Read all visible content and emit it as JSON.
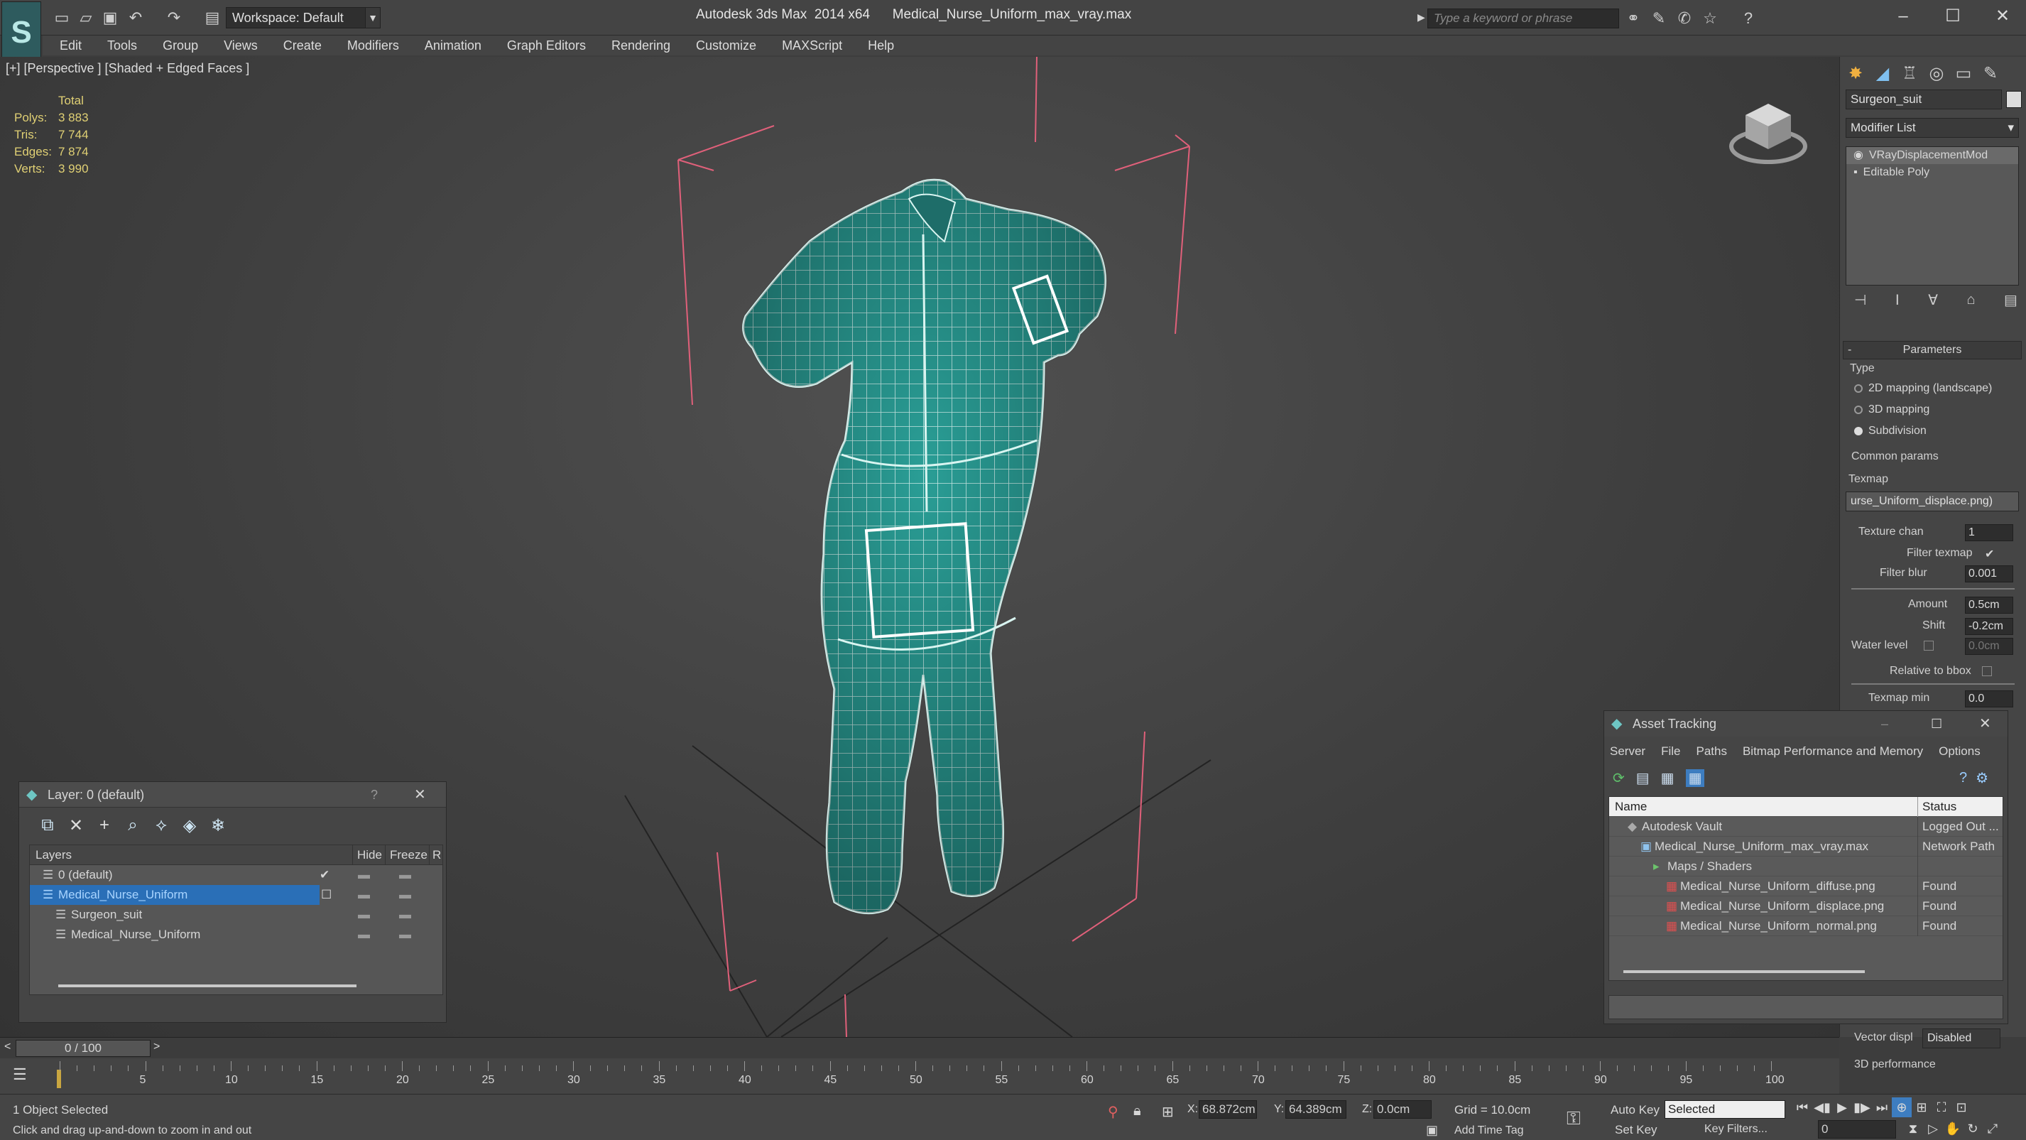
{
  "titlebar": {
    "workspace": "Workspace: Default",
    "app_title": "Autodesk 3ds Max  2014 x64",
    "file_name": "Medical_Nurse_Uniform_max_vray.max",
    "search_placeholder": "Type a keyword or phrase"
  },
  "menu": [
    "Edit",
    "Tools",
    "Group",
    "Views",
    "Create",
    "Modifiers",
    "Animation",
    "Graph Editors",
    "Rendering",
    "Customize",
    "MAXScript",
    "Help"
  ],
  "viewport": {
    "label": "[+] [Perspective ] [Shaded + Edged Faces ]",
    "stats": {
      "header": "Total",
      "rows": [
        {
          "k": "Polys:",
          "v": "3 883"
        },
        {
          "k": "Tris:",
          "v": "7 744"
        },
        {
          "k": "Edges:",
          "v": "7 874"
        },
        {
          "k": "Verts:",
          "v": "3 990"
        }
      ]
    },
    "mesh_color": "#2a9e96"
  },
  "layer_panel": {
    "title": "Layer: 0 (default)",
    "help": "?",
    "columns": {
      "layers": "Layers",
      "hide": "Hide",
      "freeze": "Freeze",
      "render": "R"
    },
    "rows": [
      {
        "name": "0 (default)",
        "indent": 1,
        "selected": false
      },
      {
        "name": "Medical_Nurse_Uniform",
        "indent": 1,
        "selected": true
      },
      {
        "name": "Surgeon_suit",
        "indent": 2,
        "selected": false
      },
      {
        "name": "Medical_Nurse_Uniform",
        "indent": 2,
        "selected": false
      }
    ]
  },
  "command_panel": {
    "object_name": "Surgeon_suit",
    "modifier_list": "Modifier List",
    "stack": [
      "VRayDisplacementMod",
      "Editable Poly"
    ],
    "parameters_title": "Parameters",
    "type_label": "Type",
    "type_options": [
      {
        "label": "2D mapping (landscape)",
        "on": false
      },
      {
        "label": "3D mapping",
        "on": false
      },
      {
        "label": "Subdivision",
        "on": true
      }
    ],
    "common_params": "Common params",
    "texmap_label": "Texmap",
    "texmap_value": "urse_Uniform_displace.png)",
    "texture_chan_label": "Texture chan",
    "texture_chan": "1",
    "filter_texmap": "Filter texmap",
    "filter_blur_label": "Filter blur",
    "filter_blur": "0.001",
    "amount_label": "Amount",
    "amount": "0.5cm",
    "shift_label": "Shift",
    "shift": "-0.2cm",
    "water_label": "Water level",
    "water": "0.0cm",
    "relative_bbox": "Relative to bbox",
    "texmap_min_label": "Texmap min",
    "texmap_min": "0.0",
    "vector_disp_label": "Vector displ",
    "vector_disp": "Disabled",
    "perf_label": "3D performance"
  },
  "asset_tracking": {
    "title": "Asset Tracking",
    "menu": [
      "Server",
      "File",
      "Paths",
      "Bitmap Performance and Memory",
      "Options"
    ],
    "columns": {
      "name": "Name",
      "status": "Status"
    },
    "rows": [
      {
        "name": "Autodesk Vault",
        "status": "Logged Out ...",
        "indent": 0
      },
      {
        "name": "Medical_Nurse_Uniform_max_vray.max",
        "status": "Network Path",
        "indent": 1
      },
      {
        "name": "Maps / Shaders",
        "status": "",
        "indent": 2
      },
      {
        "name": "Medical_Nurse_Uniform_diffuse.png",
        "status": "Found",
        "indent": 3
      },
      {
        "name": "Medical_Nurse_Uniform_displace.png",
        "status": "Found",
        "indent": 3
      },
      {
        "name": "Medical_Nurse_Uniform_normal.png",
        "status": "Found",
        "indent": 3
      }
    ]
  },
  "timeline": {
    "frame": "0 / 100",
    "ticks": [
      "5",
      "10",
      "15",
      "20",
      "25",
      "30",
      "35",
      "40",
      "45",
      "50",
      "55",
      "60",
      "65",
      "70",
      "75",
      "80",
      "85",
      "90",
      "95",
      "100"
    ]
  },
  "status": {
    "selected": "1 Object Selected",
    "hint": "Click and drag up-and-down to zoom in and out",
    "x_label": "X:",
    "x": "68.872cm",
    "y_label": "Y:",
    "y": "64.389cm",
    "z_label": "Z:",
    "z": "0.0cm",
    "grid": "Grid = 10.0cm",
    "add_time_tag": "Add Time Tag",
    "auto_key": "Auto Key",
    "set_key": "Set Key",
    "key_mode": "Selected",
    "key_filters": "Key Filters...",
    "frame_field": "0"
  }
}
